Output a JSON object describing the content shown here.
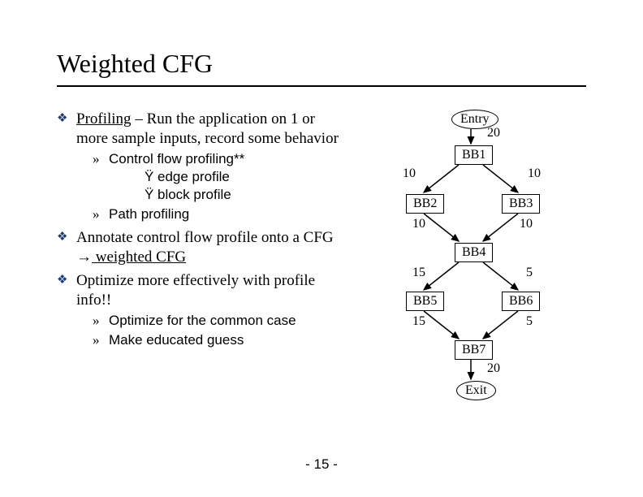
{
  "title": "Weighted CFG",
  "bullets": [
    {
      "main_prefix": "Profiling",
      "main_rest": " – Run the application on 1 or more sample inputs, record some behavior",
      "subs": [
        {
          "label": "Control flow profiling**",
          "subsubs": [
            "edge profile",
            "block profile"
          ]
        },
        {
          "label": "Path profiling",
          "subsubs": []
        }
      ]
    },
    {
      "main_prefix": "",
      "main_rest_a": "Annotate control flow profile onto a CFG ",
      "arrow": "→",
      "main_rest_b": " weighted CFG",
      "underline_b": true,
      "subs": []
    },
    {
      "main_prefix": "",
      "main_rest": "Optimize more effectively with profile info!!",
      "subs": [
        {
          "label": "Optimize for the common case",
          "subsubs": []
        },
        {
          "label": "Make educated guess",
          "subsubs": []
        }
      ]
    }
  ],
  "diagram": {
    "entry": "Entry",
    "exit": "Exit",
    "bb1": "BB1",
    "bb2": "BB2",
    "bb3": "BB3",
    "bb4": "BB4",
    "bb5": "BB5",
    "bb6": "BB6",
    "bb7": "BB7",
    "w_entry_bb1": "20",
    "w_bb1_bb2": "10",
    "w_bb1_bb3": "10",
    "w_bb2_bb4": "10",
    "w_bb3_bb4": "10",
    "w_bb4_bb5": "15",
    "w_bb4_bb6": "5",
    "w_bb5_bb7": "15",
    "w_bb6_bb7": "5",
    "w_bb7_exit": "20"
  },
  "page_number": "- 15 -",
  "chart_data": {
    "type": "diagram",
    "description": "Weighted control-flow graph",
    "nodes": [
      "Entry",
      "BB1",
      "BB2",
      "BB3",
      "BB4",
      "BB5",
      "BB6",
      "BB7",
      "Exit"
    ],
    "edges": [
      {
        "from": "Entry",
        "to": "BB1",
        "weight": 20
      },
      {
        "from": "BB1",
        "to": "BB2",
        "weight": 10
      },
      {
        "from": "BB1",
        "to": "BB3",
        "weight": 10
      },
      {
        "from": "BB2",
        "to": "BB4",
        "weight": 10
      },
      {
        "from": "BB3",
        "to": "BB4",
        "weight": 10
      },
      {
        "from": "BB4",
        "to": "BB5",
        "weight": 15
      },
      {
        "from": "BB4",
        "to": "BB6",
        "weight": 5
      },
      {
        "from": "BB5",
        "to": "BB7",
        "weight": 15
      },
      {
        "from": "BB6",
        "to": "BB7",
        "weight": 5
      },
      {
        "from": "BB7",
        "to": "Exit",
        "weight": 20
      }
    ]
  }
}
